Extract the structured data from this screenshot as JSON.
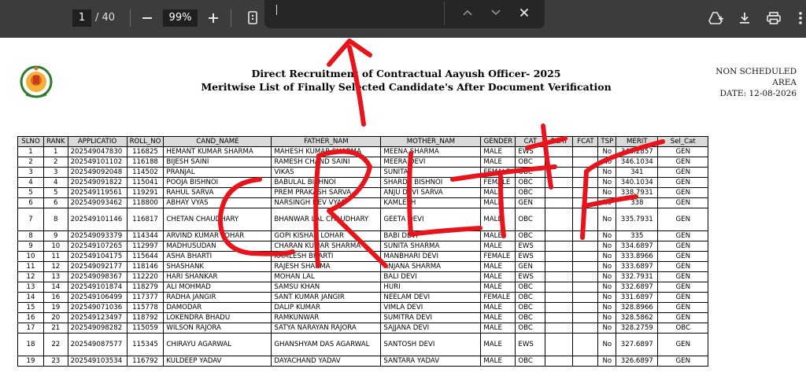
{
  "toolbar": {
    "page_current": "1",
    "page_total": "/ 40",
    "zoom_value": "99%",
    "icons": [
      "minus-icon",
      "plus-icon",
      "document-icon",
      "add-to-drive-icon",
      "download-icon",
      "print-icon",
      "more-icon"
    ]
  },
  "find": {
    "query": "",
    "icons": [
      "chevron-up-icon",
      "chevron-down-icon",
      "close-icon"
    ]
  },
  "doc": {
    "title_line1": "Direct Recruitment of Contractual Aayush Officer- 2025",
    "title_line2": "Meritwise List of Finally Selected Candidate's After Document Verification",
    "area_line1": "NON SCHEDULED AREA",
    "area_line2": "DATE: 12-08-2026",
    "columns": [
      "SLNO",
      "RANK",
      "APPLICATIO",
      "ROLL_NO",
      "CAND_NAME",
      "FATHER_NAM",
      "MOTHER_NAM",
      "GENDER",
      "CAT",
      "PCAT",
      "FCAT",
      "TSP",
      "MERIT",
      "Sel_Cat"
    ],
    "rows": [
      {
        "slno": "1",
        "rank": "1",
        "app": "202549047830",
        "roll": "116825",
        "cand": "HEMANT KUMAR SHARMA",
        "father": "MAHESH KUMAR SHARMA",
        "mother": "MEENA SHARMA",
        "gender": "MALE",
        "cat": "EWS",
        "pcat": "",
        "fcat": "",
        "tsp": "No",
        "merit": "346.2857",
        "sel": "GEN"
      },
      {
        "slno": "2",
        "rank": "2",
        "app": "202549101102",
        "roll": "116188",
        "cand": "BIJESH SAINI",
        "father": "RAMESH CHAND SAINI",
        "mother": "MEERA DEVI",
        "gender": "MALE",
        "cat": "OBC",
        "pcat": "",
        "fcat": "",
        "tsp": "No",
        "merit": "346.1034",
        "sel": "GEN"
      },
      {
        "slno": "3",
        "rank": "3",
        "app": "202549092048",
        "roll": "114502",
        "cand": "PRANJAL",
        "father": "VIKAS",
        "mother": "SUNITA",
        "gender": "FEMALE",
        "cat": "OBC",
        "pcat": "",
        "fcat": "",
        "tsp": "No",
        "merit": "341",
        "sel": "GEN"
      },
      {
        "slno": "4",
        "rank": "4",
        "app": "202549091822",
        "roll": "115041",
        "cand": "POOJA BISHNOI",
        "father": "BABULAL BISHNOI",
        "mother": "SHARDA BISHNOI",
        "gender": "FEMALE",
        "cat": "OBC",
        "pcat": "",
        "fcat": "",
        "tsp": "No",
        "merit": "340.1034",
        "sel": "GEN"
      },
      {
        "slno": "5",
        "rank": "5",
        "app": "202549119561",
        "roll": "119291",
        "cand": "RAHUL SARVA",
        "father": "PREM PRAKASH SARVA",
        "mother": "ANJU DEVI SARVA",
        "gender": "MALE",
        "cat": "OBC",
        "pcat": "",
        "fcat": "",
        "tsp": "No",
        "merit": "338.7931",
        "sel": "GEN"
      },
      {
        "slno": "6",
        "rank": "6",
        "app": "202549093462",
        "roll": "118800",
        "cand": "ABHAY VYAS",
        "father": "NARSINGH DEV VYAS",
        "mother": "KAMLESH",
        "gender": "MALE",
        "cat": "GEN",
        "pcat": "",
        "fcat": "",
        "tsp": "No",
        "merit": "338",
        "sel": "GEN"
      },
      {
        "slno": "7",
        "rank": "8",
        "app": "202549101146",
        "roll": "116817",
        "cand": "CHETAN CHAUDHARY",
        "father": "BHANWAR LAL CHAUDHARY",
        "mother": "GEETA DEVI",
        "gender": "MALE",
        "cat": "OBC",
        "pcat": "",
        "fcat": "",
        "tsp": "No",
        "merit": "335.7931",
        "sel": "GEN",
        "tall": true
      },
      {
        "slno": "8",
        "rank": "9",
        "app": "202549093379",
        "roll": "114344",
        "cand": "ARVIND KUMAR LOHAR",
        "father": "GOPI KISHAN LOHAR",
        "mother": "BABI DEVI",
        "gender": "MALE",
        "cat": "OBC",
        "pcat": "",
        "fcat": "",
        "tsp": "No",
        "merit": "335",
        "sel": "GEN"
      },
      {
        "slno": "9",
        "rank": "10",
        "app": "202549107265",
        "roll": "112997",
        "cand": "MADHUSUDAN",
        "father": "CHARAN KUMAR SHARMA",
        "mother": "SUNITA SHARMA",
        "gender": "MALE",
        "cat": "EWS",
        "pcat": "",
        "fcat": "",
        "tsp": "No",
        "merit": "334.6897",
        "sel": "GEN"
      },
      {
        "slno": "10",
        "rank": "11",
        "app": "202549104175",
        "roll": "115644",
        "cand": "ASHA BHARTI",
        "father": "KAMLESH BHARTI",
        "mother": "MANBHARI DEVI",
        "gender": "FEMALE",
        "cat": "EWS",
        "pcat": "",
        "fcat": "",
        "tsp": "No",
        "merit": "333.8966",
        "sel": "GEN"
      },
      {
        "slno": "11",
        "rank": "12",
        "app": "202549092177",
        "roll": "118146",
        "cand": "SHASHANK",
        "father": "RAJESH SHARMA",
        "mother": "ANJANA SHARMA",
        "gender": "MALE",
        "cat": "GEN",
        "pcat": "",
        "fcat": "",
        "tsp": "No",
        "merit": "333.6897",
        "sel": "GEN"
      },
      {
        "slno": "12",
        "rank": "13",
        "app": "202549098367",
        "roll": "112220",
        "cand": "HARI SHANKAR",
        "father": "MOHAN LAL",
        "mother": "BALI DEVI",
        "gender": "MALE",
        "cat": "EWS",
        "pcat": "",
        "fcat": "",
        "tsp": "No",
        "merit": "332.7931",
        "sel": "GEN"
      },
      {
        "slno": "13",
        "rank": "14",
        "app": "202549101874",
        "roll": "118279",
        "cand": "ALI MOHMAD",
        "father": "SAMSU KHAN",
        "mother": "HURI",
        "gender": "MALE",
        "cat": "OBC",
        "pcat": "",
        "fcat": "",
        "tsp": "No",
        "merit": "332.6897",
        "sel": "GEN"
      },
      {
        "slno": "14",
        "rank": "16",
        "app": "202549106499",
        "roll": "117377",
        "cand": "RADHA JANGIR",
        "father": "SANT KUMAR JANGIR",
        "mother": "NEELAM DEVI",
        "gender": "FEMALE",
        "cat": "OBC",
        "pcat": "",
        "fcat": "",
        "tsp": "No",
        "merit": "331.6897",
        "sel": "GEN"
      },
      {
        "slno": "15",
        "rank": "19",
        "app": "202549071036",
        "roll": "115778",
        "cand": "DAMODAR",
        "father": "DALIP KUMAR",
        "mother": "VIMLA DEVI",
        "gender": "MALE",
        "cat": "OBC",
        "pcat": "",
        "fcat": "",
        "tsp": "No",
        "merit": "328.8966",
        "sel": "GEN"
      },
      {
        "slno": "16",
        "rank": "20",
        "app": "202549123497",
        "roll": "118792",
        "cand": "LOKENDRA BHADU",
        "father": "RAMKUNWAR",
        "mother": "SUMITRA DEVI",
        "gender": "MALE",
        "cat": "OBC",
        "pcat": "",
        "fcat": "",
        "tsp": "No",
        "merit": "328.5862",
        "sel": "GEN"
      },
      {
        "slno": "17",
        "rank": "21",
        "app": "202549098282",
        "roll": "115059",
        "cand": "WILSON RAJORA",
        "father": "SATYA NARAYAN RAJORA",
        "mother": "SAJJANA DEVI",
        "gender": "MALE",
        "cat": "OBC",
        "pcat": "",
        "fcat": "",
        "tsp": "No",
        "merit": "328.2759",
        "sel": "OBC"
      },
      {
        "slno": "18",
        "rank": "22",
        "app": "202549087577",
        "roll": "115345",
        "cand": "CHIRAYU AGARWAL",
        "father": "GHANSHYAM DAS AGARWAL",
        "mother": "SANTOSH DEVI",
        "gender": "MALE",
        "cat": "EWS",
        "pcat": "",
        "fcat": "",
        "tsp": "No",
        "merit": "327.6897",
        "sel": "GEN",
        "tall": true
      },
      {
        "slno": "19",
        "rank": "23",
        "app": "202549103534",
        "roll": "116792",
        "cand": "KULDEEP YADAV",
        "father": "DAYACHAND YADAV",
        "mother": "SANTARA YADAV",
        "gender": "MALE",
        "cat": "OBC",
        "pcat": "",
        "fcat": "",
        "tsp": "No",
        "merit": "326.6897",
        "sel": "GEN"
      }
    ]
  },
  "annotation": {
    "text": "CRLTF",
    "color": "#e8141c"
  }
}
